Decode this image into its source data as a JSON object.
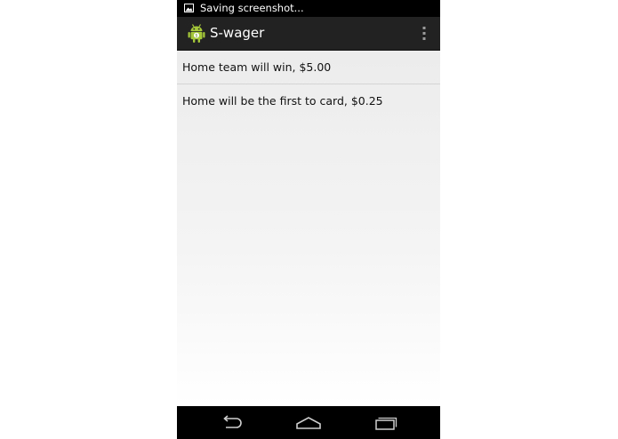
{
  "status_bar": {
    "notification_icon": "image-icon",
    "text": "Saving screenshot..."
  },
  "action_bar": {
    "app_icon": "android-app-icon",
    "title": "S-wager",
    "overflow_icon": "overflow-menu-icon"
  },
  "wagers": [
    {
      "label": "Home team will win, $5.00"
    },
    {
      "label": "Home will be the first to card, $0.25"
    }
  ],
  "nav_bar": {
    "back_icon": "back-icon",
    "home_icon": "home-icon",
    "recents_icon": "recents-icon"
  }
}
